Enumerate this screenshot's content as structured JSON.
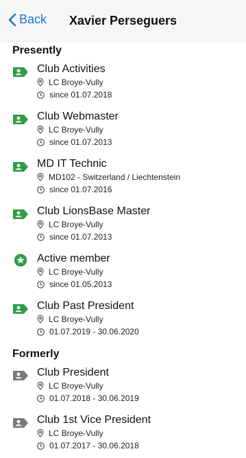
{
  "header": {
    "back_label": "Back",
    "title": "Xavier Perseguers"
  },
  "colors": {
    "accent": "#1976d2",
    "active": "#2f9e44",
    "former": "#7a7a7a"
  },
  "sections": [
    {
      "title": "Presently",
      "items": [
        {
          "name": "Club Activities",
          "place": "LC Broye-Vully",
          "period": "since 01.07.2018",
          "icon": "id-badge-icon"
        },
        {
          "name": "Club Webmaster",
          "place": "LC Broye-Vully",
          "period": "since 01.07.2013",
          "icon": "id-badge-icon"
        },
        {
          "name": "MD IT Technic",
          "place": "MD102 - Switzerland / Liechtenstein",
          "period": "since 01.07.2016",
          "icon": "id-badge-icon"
        },
        {
          "name": "Club LionsBase Master",
          "place": "LC Broye-Vully",
          "period": "since 01.07.2013",
          "icon": "id-badge-icon"
        },
        {
          "name": "Active member",
          "place": "LC Broye-Vully",
          "period": "since 01.05.2013",
          "icon": "star-circle-icon"
        },
        {
          "name": "Club Past President",
          "place": "LC Broye-Vully",
          "period": "01.07.2019 - 30.06.2020",
          "icon": "id-badge-icon"
        }
      ]
    },
    {
      "title": "Formerly",
      "items": [
        {
          "name": "Club President",
          "place": "LC Broye-Vully",
          "period": "01.07.2018 - 30.06.2019",
          "icon": "id-badge-icon"
        },
        {
          "name": "Club 1st Vice President",
          "place": "LC Broye-Vully",
          "period": "01.07.2017 - 30.06.2018",
          "icon": "id-badge-icon"
        }
      ]
    }
  ]
}
